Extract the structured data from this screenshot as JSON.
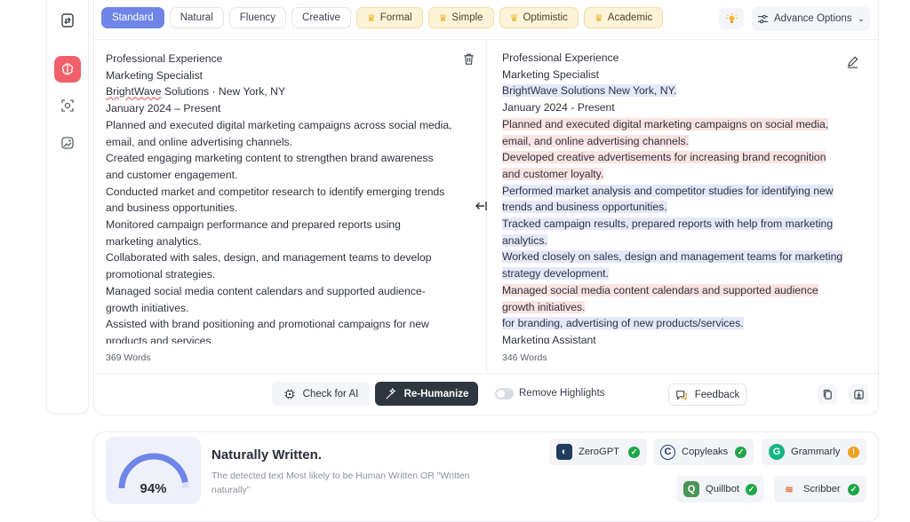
{
  "tones": [
    {
      "label": "Standard",
      "active": true,
      "premium": false
    },
    {
      "label": "Natural",
      "active": false,
      "premium": false
    },
    {
      "label": "Fluency",
      "active": false,
      "premium": false
    },
    {
      "label": "Creative",
      "active": false,
      "premium": false
    },
    {
      "label": "Formal",
      "active": false,
      "premium": true
    },
    {
      "label": "Simple",
      "active": false,
      "premium": true
    },
    {
      "label": "Optimistic",
      "active": false,
      "premium": true
    },
    {
      "label": "Academic",
      "active": false,
      "premium": true
    }
  ],
  "advance_options_label": "Advance Options",
  "input": {
    "lines": [
      "Professional Experience",
      "Marketing Specialist",
      "BrightWave Solutions · New York, NY",
      "January 2024 – Present",
      "Planned and executed digital marketing campaigns across social media,",
      "email, and online advertising channels.",
      "Created engaging marketing content to strengthen brand awareness",
      "and customer engagement.",
      "Conducted market and competitor research to identify emerging trends",
      "and business opportunities.",
      "Monitored campaign performance and prepared reports using",
      "marketing analytics.",
      "Collaborated with sales, design, and management teams to develop",
      "promotional strategies.",
      "Managed social media content calendars and supported audience-",
      "growth initiatives.",
      "Assisted with brand positioning and promotional campaigns for new",
      "products and services."
    ],
    "word_count": "369 Words"
  },
  "output": {
    "lines": [
      {
        "text": "Professional Experience",
        "hl": ""
      },
      {
        "text": "Marketing Specialist",
        "hl": ""
      },
      {
        "text": "BrightWave Solutions New York, NY.",
        "hl": "b"
      },
      {
        "text": "January 2024 - Present",
        "hl": ""
      },
      {
        "text": "Planned and executed digital marketing campaigns on social media,",
        "hl": "r"
      },
      {
        "text": "email, and online advertising channels.",
        "hl": "r"
      },
      {
        "text": "Developed creative advertisements for increasing brand recognition",
        "hl": "r"
      },
      {
        "text": "and customer loyalty.",
        "hl": "r"
      },
      {
        "text": "Performed market analysis and competitor studies for identifying new",
        "hl": "b"
      },
      {
        "text": "trends and business opportunities.",
        "hl": "b"
      },
      {
        "text": "Tracked campaign results, prepared reports with help from marketing",
        "hl": "b"
      },
      {
        "text": "analytics.",
        "hl": "b"
      },
      {
        "text": "Worked closely on sales, design and management teams for marketing",
        "hl": "b"
      },
      {
        "text": "strategy development.",
        "hl": "b"
      },
      {
        "text": "Managed social media content calendars and supported audience",
        "hl": "r"
      },
      {
        "text": "growth initiatives.",
        "hl": "r"
      },
      {
        "text": "for branding, advertising of new products/services.",
        "hl": "b"
      },
      {
        "text": "Marketing Assistant",
        "hl": ""
      }
    ],
    "word_count": "346 Words"
  },
  "actions": {
    "check_ai": "Check for AI",
    "rehumanize": "Re-Humanize",
    "remove_highlights": "Remove Highlights",
    "feedback": "Feedback"
  },
  "result": {
    "score": "94%",
    "score_value": 0.94,
    "title": "Naturally Written.",
    "description_line1": "The detected text Most likely to be Human Written OR \"Written",
    "description_line2": "naturally\""
  },
  "detectors": [
    {
      "name": "ZeroGPT",
      "status": "pass"
    },
    {
      "name": "Copyleaks",
      "status": "pass"
    },
    {
      "name": "Grammarly",
      "status": "warning"
    },
    {
      "name": "Quillbot",
      "status": "pass"
    },
    {
      "name": "Scribber",
      "status": "pass"
    }
  ],
  "colors": {
    "accent": "#6f86e8",
    "rail_active": "#f1606a",
    "pass": "#1fa64a",
    "warning": "#f0a020",
    "highlight_red": "#fbe3e1",
    "highlight_blue": "#e4e8fa"
  }
}
